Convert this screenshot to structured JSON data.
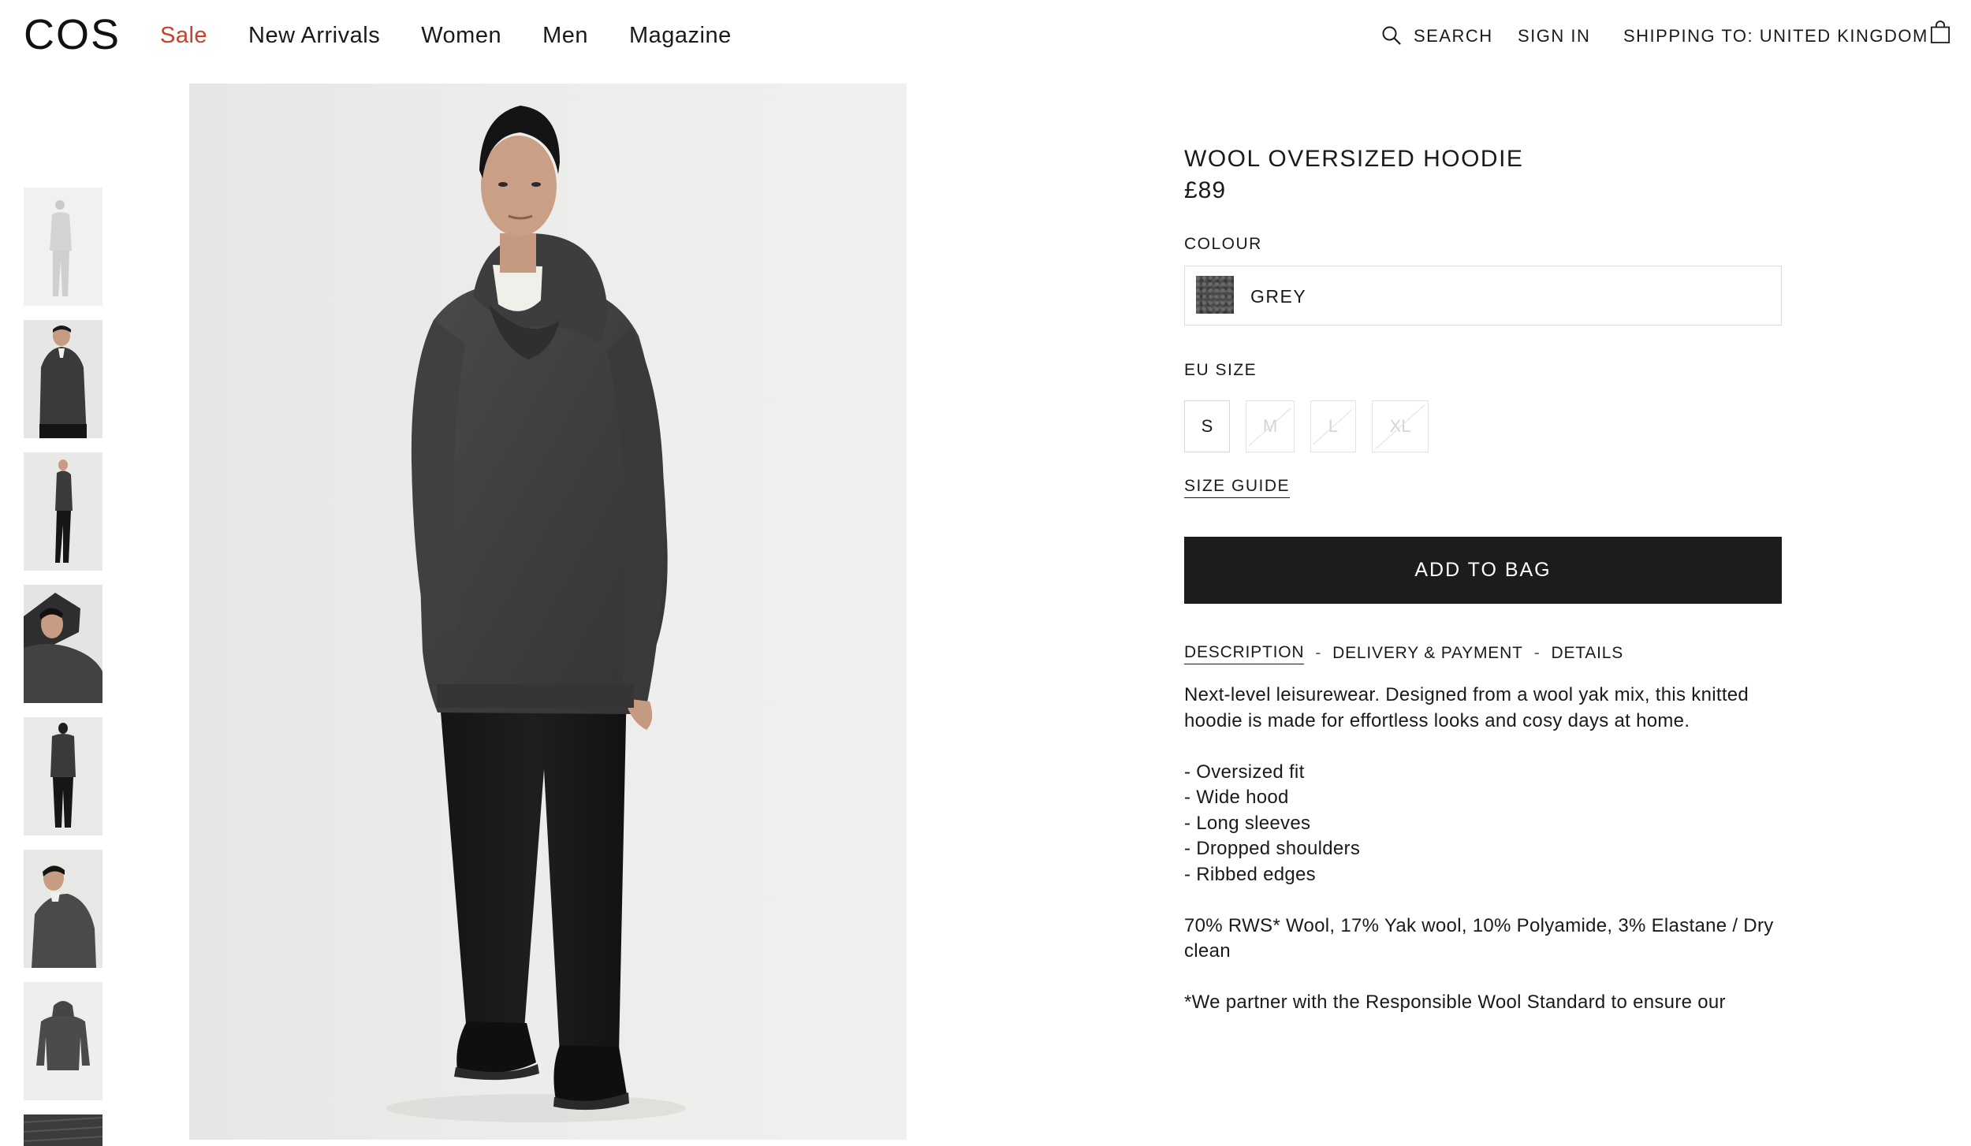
{
  "header": {
    "logo": "COS",
    "nav": [
      "Sale",
      "New Arrivals",
      "Women",
      "Men",
      "Magazine"
    ],
    "search_label": "SEARCH",
    "sign_in_label": "SIGN IN",
    "shipping_label": "SHIPPING TO: UNITED KINGDOM",
    "search_icon": "search-icon",
    "bag_icon": "shopping-bag-icon"
  },
  "colors": {
    "sale": "#c8412b",
    "button": "#1c1c1c",
    "text": "#1a1a1a"
  },
  "product": {
    "name": "WOOL OVERSIZED HOODIE",
    "price": "£89",
    "colour_label": "COLOUR",
    "colour_value": "GREY",
    "size_label": "EU SIZE",
    "sizes": [
      {
        "label": "S",
        "available": true
      },
      {
        "label": "M",
        "available": false
      },
      {
        "label": "L",
        "available": false
      },
      {
        "label": "XL",
        "available": false
      }
    ],
    "size_guide": "SIZE GUIDE",
    "add_to_bag": "ADD TO BAG",
    "tabs": [
      "DESCRIPTION",
      "DELIVERY & PAYMENT",
      "DETAILS"
    ],
    "tab_separator": "-",
    "description": [
      "Next-level leisurewear. Designed from a wool yak mix, this knitted hoodie is made for effortless looks and cosy days at home.",
      "",
      "- Oversized fit",
      "- Wide hood",
      "- Long sleeves",
      "- Dropped shoulders",
      "- Ribbed edges",
      "",
      "70% RWS* Wool, 17% Yak wool, 10% Polyamide, 3% Elastane / Dry clean",
      "",
      "*We partner with the Responsible Wool Standard to ensure our"
    ]
  },
  "gallery": {
    "thumbnails": [
      "full-body-front",
      "upper-body-front",
      "full-body-side",
      "hand-on-head",
      "full-body-back",
      "upper-body-side",
      "hoodie-flat",
      "fabric-detail"
    ]
  }
}
